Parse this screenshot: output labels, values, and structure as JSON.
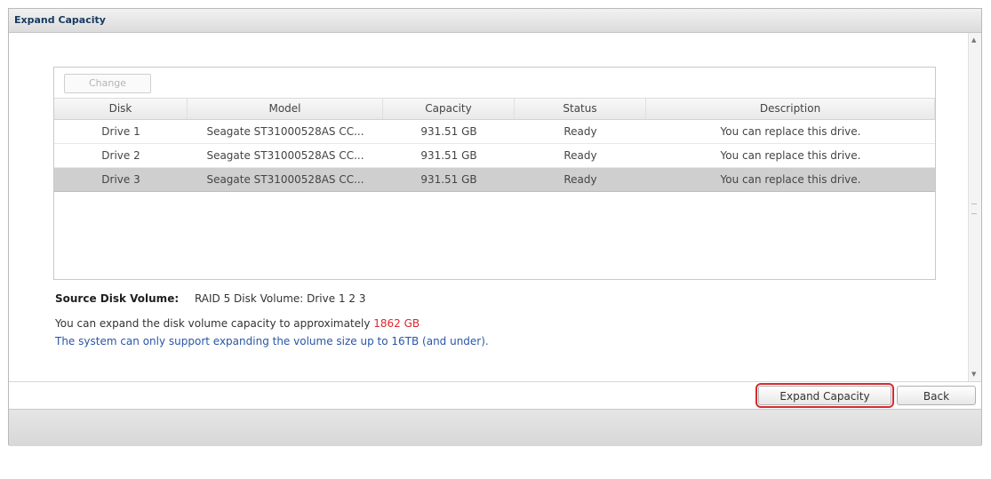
{
  "window": {
    "title": "Expand Capacity"
  },
  "toolbar": {
    "change_label": "Change"
  },
  "table": {
    "columns": [
      "Disk",
      "Model",
      "Capacity",
      "Status",
      "Description"
    ],
    "rows": [
      {
        "disk": "Drive 1",
        "model": "Seagate ST31000528AS CC...",
        "capacity": "931.51 GB",
        "status": "Ready",
        "description": "You can replace this drive."
      },
      {
        "disk": "Drive 2",
        "model": "Seagate ST31000528AS CC...",
        "capacity": "931.51 GB",
        "status": "Ready",
        "description": "You can replace this drive."
      },
      {
        "disk": "Drive 3",
        "model": "Seagate ST31000528AS CC...",
        "capacity": "931.51 GB",
        "status": "Ready",
        "description": "You can replace this drive."
      }
    ],
    "selected_row_index": 2
  },
  "info": {
    "source_label": "Source Disk Volume:",
    "source_value": "RAID 5 Disk Volume: Drive 1 2 3",
    "expand_text": "You can expand the disk volume capacity to approximately ",
    "expand_value": "1862 GB",
    "limit_text": "The system can only support expanding the volume size up to 16TB (and under)."
  },
  "buttons": {
    "expand_label": "Expand Capacity",
    "back_label": "Back"
  },
  "colors": {
    "highlight": "#e0262c",
    "limit_text": "#2a56a6",
    "button_outline": "#d42b30",
    "selected_row": "#cfcfcf"
  },
  "icons": {
    "scroll_up": "scroll-up-arrow-icon",
    "scroll_down": "scroll-down-arrow-icon"
  }
}
